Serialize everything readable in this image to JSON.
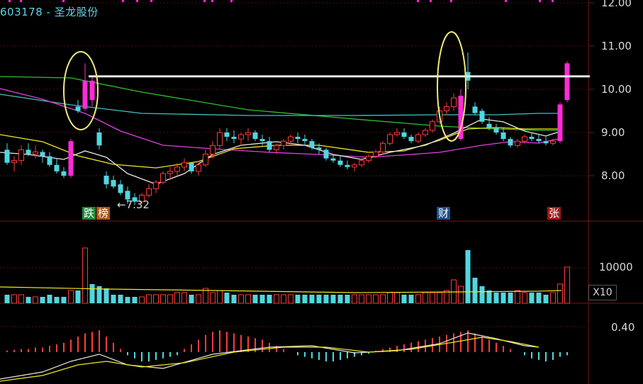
{
  "header": {
    "title": "603178 - 圣龙股份"
  },
  "price_panel": {
    "y_ticks": [
      "12.00",
      "11.00",
      "10.00",
      "9.00",
      "8.00"
    ],
    "low_marker": "←7.32",
    "reference_line_price": 10.3
  },
  "event_tags": {
    "tag1": "跌",
    "tag2": "榜",
    "tag3": "财",
    "tag4": "张"
  },
  "volume_panel": {
    "y_tick": "10000",
    "multiplier": "X10"
  },
  "macd_panel": {
    "y_tick": "0.40"
  },
  "colors": {
    "up_candle": "#ff3b3b",
    "down_candle": "#4fd7e0",
    "limit_up": "#ff2bd6",
    "ma5": "#e8e8e8",
    "ma10": "#f2e81e",
    "ma20": "#e040e0",
    "ma60": "#3fc3c3",
    "ma120": "#2fbf2f",
    "highlight_ellipse": "#f0ea7a"
  },
  "chart_data": {
    "type": "candlestick",
    "candles": [
      [
        8.6,
        8.75,
        8.25,
        8.3
      ],
      [
        8.3,
        8.45,
        8.1,
        8.35
      ],
      [
        8.35,
        8.7,
        8.25,
        8.6
      ],
      [
        8.6,
        8.75,
        8.45,
        8.5
      ],
      [
        8.5,
        8.7,
        8.4,
        8.55
      ],
      [
        8.55,
        8.6,
        8.3,
        8.45
      ],
      [
        8.45,
        8.55,
        8.2,
        8.25
      ],
      [
        8.25,
        8.4,
        8.05,
        8.1
      ],
      [
        8.1,
        8.2,
        7.95,
        8.0
      ],
      [
        8.0,
        8.85,
        7.95,
        8.8
      ],
      [
        9.6,
        9.75,
        9.45,
        9.5
      ],
      [
        9.55,
        10.6,
        9.5,
        10.2
      ],
      [
        10.2,
        10.3,
        9.6,
        9.75
      ],
      [
        9.0,
        9.1,
        8.6,
        8.7
      ],
      [
        8.0,
        8.1,
        7.7,
        7.8
      ],
      [
        7.9,
        8.0,
        7.7,
        7.75
      ],
      [
        7.8,
        7.9,
        7.55,
        7.6
      ],
      [
        7.65,
        7.75,
        7.35,
        7.45
      ],
      [
        7.5,
        7.6,
        7.32,
        7.4
      ],
      [
        7.4,
        7.6,
        7.35,
        7.55
      ],
      [
        7.55,
        7.8,
        7.5,
        7.7
      ],
      [
        7.7,
        7.9,
        7.6,
        7.85
      ],
      [
        7.85,
        8.1,
        7.8,
        8.05
      ],
      [
        8.05,
        8.2,
        7.9,
        8.1
      ],
      [
        8.1,
        8.3,
        8.0,
        8.2
      ],
      [
        8.2,
        8.4,
        8.1,
        8.3
      ],
      [
        8.3,
        8.2,
        8.05,
        8.1
      ],
      [
        8.1,
        8.3,
        8.0,
        8.25
      ],
      [
        8.25,
        8.6,
        8.2,
        8.5
      ],
      [
        8.5,
        8.8,
        8.4,
        8.7
      ],
      [
        8.7,
        9.1,
        8.6,
        9.0
      ],
      [
        9.0,
        9.1,
        8.8,
        8.9
      ],
      [
        8.9,
        9.05,
        8.75,
        8.85
      ],
      [
        8.85,
        9.0,
        8.7,
        8.95
      ],
      [
        8.95,
        9.1,
        8.8,
        9.0
      ],
      [
        9.0,
        9.05,
        8.8,
        8.85
      ],
      [
        8.85,
        8.95,
        8.7,
        8.8
      ],
      [
        8.8,
        8.9,
        8.55,
        8.6
      ],
      [
        8.6,
        8.75,
        8.5,
        8.7
      ],
      [
        8.7,
        8.85,
        8.6,
        8.8
      ],
      [
        8.8,
        8.95,
        8.7,
        8.9
      ],
      [
        8.9,
        9.0,
        8.75,
        8.85
      ],
      [
        8.85,
        8.95,
        8.7,
        8.8
      ],
      [
        8.8,
        8.85,
        8.6,
        8.65
      ],
      [
        8.65,
        8.75,
        8.5,
        8.6
      ],
      [
        8.6,
        8.65,
        8.35,
        8.4
      ],
      [
        8.4,
        8.5,
        8.3,
        8.35
      ],
      [
        8.35,
        8.45,
        8.2,
        8.25
      ],
      [
        8.25,
        8.35,
        8.15,
        8.2
      ],
      [
        8.2,
        8.3,
        8.1,
        8.25
      ],
      [
        8.25,
        8.4,
        8.2,
        8.35
      ],
      [
        8.35,
        8.5,
        8.3,
        8.45
      ],
      [
        8.45,
        8.6,
        8.4,
        8.55
      ],
      [
        8.55,
        8.8,
        8.5,
        8.75
      ],
      [
        8.75,
        9.0,
        8.7,
        8.95
      ],
      [
        8.95,
        9.1,
        8.9,
        9.0
      ],
      [
        9.0,
        9.1,
        8.85,
        8.9
      ],
      [
        8.9,
        8.95,
        8.75,
        8.8
      ],
      [
        8.8,
        9.0,
        8.75,
        8.95
      ],
      [
        8.95,
        9.1,
        8.9,
        9.05
      ],
      [
        9.05,
        9.3,
        9.0,
        9.25
      ],
      [
        9.25,
        9.6,
        9.2,
        9.5
      ],
      [
        9.5,
        9.7,
        9.4,
        9.6
      ],
      [
        9.6,
        9.9,
        9.5,
        9.8
      ],
      [
        8.85,
        10.0,
        8.8,
        9.85
      ],
      [
        10.4,
        10.85,
        10.0,
        10.2
      ],
      [
        9.6,
        9.7,
        9.4,
        9.45
      ],
      [
        9.5,
        9.55,
        9.2,
        9.25
      ],
      [
        9.2,
        9.35,
        9.05,
        9.1
      ],
      [
        9.1,
        9.2,
        8.95,
        9.0
      ],
      [
        9.0,
        9.1,
        8.8,
        8.85
      ],
      [
        8.85,
        8.9,
        8.65,
        8.7
      ],
      [
        8.7,
        8.85,
        8.65,
        8.8
      ],
      [
        8.8,
        8.95,
        8.75,
        8.9
      ],
      [
        8.9,
        9.0,
        8.8,
        8.85
      ],
      [
        8.85,
        8.95,
        8.75,
        8.8
      ],
      [
        8.8,
        8.9,
        8.7,
        8.75
      ],
      [
        8.75,
        8.85,
        8.7,
        8.8
      ],
      [
        8.8,
        9.7,
        8.75,
        9.65
      ],
      [
        9.75,
        10.65,
        9.7,
        10.6
      ]
    ],
    "ma_series": [
      "MA5",
      "MA10",
      "MA20",
      "MA60",
      "MA120"
    ],
    "volume": [
      2,
      2,
      2,
      1.5,
      1.5,
      1.5,
      2,
      1.5,
      1.5,
      3,
      3,
      13,
      4.5,
      4,
      3.5,
      2,
      2,
      1.5,
      1.5,
      1.5,
      2,
      2,
      2,
      2,
      2.5,
      2.5,
      2,
      2,
      3.5,
      2.5,
      3,
      2.5,
      2,
      2,
      2,
      2,
      2,
      2,
      2,
      2,
      2,
      2,
      2,
      2,
      2,
      2,
      2,
      2,
      2,
      2,
      2,
      2,
      2,
      2,
      2.5,
      2.5,
      2,
      2,
      2,
      2.5,
      2.5,
      2.5,
      3,
      5.5,
      4,
      12.5,
      6,
      4,
      3,
      2.5,
      2.5,
      2.5,
      3,
      2.5,
      2.5,
      2.5,
      2,
      2.5,
      4.5,
      8.5
    ]
  }
}
